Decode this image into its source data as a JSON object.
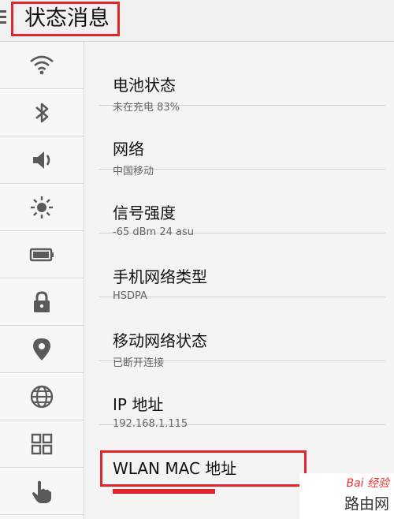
{
  "header": {
    "title": "状态消息"
  },
  "sidebar": {
    "items": [
      {
        "icon": "wifi-icon"
      },
      {
        "icon": "bluetooth-icon"
      },
      {
        "icon": "volume-icon"
      },
      {
        "icon": "brightness-icon"
      },
      {
        "icon": "battery-icon"
      },
      {
        "icon": "lock-icon"
      },
      {
        "icon": "location-icon"
      },
      {
        "icon": "globe-icon"
      },
      {
        "icon": "apps-grid-icon"
      },
      {
        "icon": "hand-pointer-icon"
      }
    ]
  },
  "rows": [
    {
      "title": "电池状态",
      "subtitle": "未在充电   83%"
    },
    {
      "title": "网络",
      "subtitle": "中国移动"
    },
    {
      "title": "信号强度",
      "subtitle": "-65 dBm   24 asu"
    },
    {
      "title": "手机网络类型",
      "subtitle": "HSDPA"
    },
    {
      "title": "移动网络状态",
      "subtitle": "已断开连接"
    },
    {
      "title": "IP 地址",
      "subtitle": "192.168.1.115"
    },
    {
      "title": "WLAN MAC 地址",
      "subtitle": ""
    }
  ],
  "watermark": {
    "brand": "Bai 经验",
    "site": "路由网"
  },
  "colors": {
    "highlight": "#e3262a",
    "icon": "#5a5a5a"
  }
}
